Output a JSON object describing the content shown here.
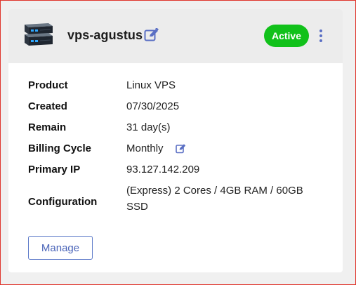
{
  "server": {
    "name": "vps-agustus",
    "status": "Active",
    "status_color": "#11c11a",
    "icons": {
      "server": "server-rack-icon",
      "edit": "edit-pencil-icon",
      "menu": "kebab-menu-icon"
    }
  },
  "details": [
    {
      "label": "Product",
      "value": "Linux VPS"
    },
    {
      "label": "Created",
      "value": "07/30/2025"
    },
    {
      "label": "Remain",
      "value": "31 day(s)"
    },
    {
      "label": "Billing Cycle",
      "value": "Monthly"
    },
    {
      "label": "Primary IP",
      "value": "93.127.142.209"
    },
    {
      "label": "Configuration",
      "value_line1": "(Express) 2 Cores / 4GB RAM / 60GB",
      "value_line2": "SSD"
    }
  ],
  "actions": {
    "manage_label": "Manage"
  },
  "colors": {
    "accent": "#5a6fc4",
    "header_bg": "#ececec"
  }
}
